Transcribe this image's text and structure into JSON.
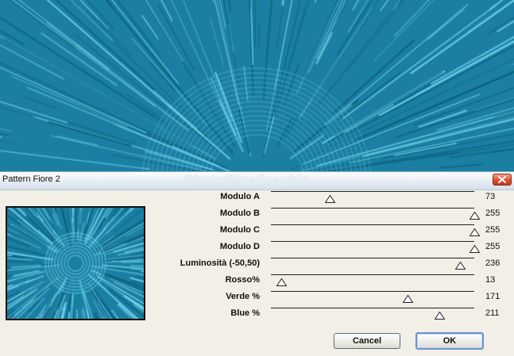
{
  "dialog": {
    "title": "Pattern Fiore 2",
    "watermark": "PhotofiltreGraphic"
  },
  "icons": {
    "close": "close-x-icon",
    "thumb": "triangle-up-icon"
  },
  "colors": {
    "pattern_base": "#1a7fa2",
    "pattern_light": "#6fd4ec",
    "dialog_bg": "#f1efe6",
    "close_button": "#d9492c"
  },
  "sliders": [
    {
      "label": "Modulo A",
      "value": "73",
      "fraction": 0.29
    },
    {
      "label": "Modulo B",
      "value": "255",
      "fraction": 1.0
    },
    {
      "label": "Modulo C",
      "value": "255",
      "fraction": 1.0
    },
    {
      "label": "Modulo D",
      "value": "255",
      "fraction": 1.0
    },
    {
      "label": "Luminosità (-50,50)",
      "value": "236",
      "fraction": 0.93
    },
    {
      "label": "Rosso%",
      "value": "13",
      "fraction": 0.05
    },
    {
      "label": "Verde %",
      "value": "171",
      "fraction": 0.67
    },
    {
      "label": "Blue %",
      "value": "211",
      "fraction": 0.83
    }
  ],
  "buttons": {
    "cancel": "Cancel",
    "ok": "OK"
  }
}
